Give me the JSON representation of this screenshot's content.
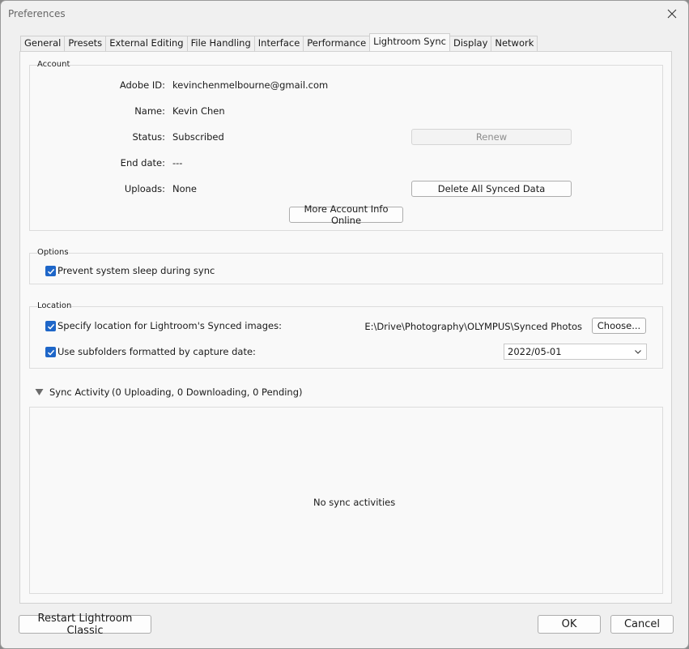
{
  "window": {
    "title": "Preferences"
  },
  "tabs": [
    {
      "label": "General"
    },
    {
      "label": "Presets"
    },
    {
      "label": "External Editing"
    },
    {
      "label": "File Handling"
    },
    {
      "label": "Interface"
    },
    {
      "label": "Performance"
    },
    {
      "label": "Lightroom Sync",
      "active": true
    },
    {
      "label": "Display"
    },
    {
      "label": "Network"
    }
  ],
  "account": {
    "group_label": "Account",
    "adobe_id_label": "Adobe ID:",
    "adobe_id_value": "kevinchenmelbourne@gmail.com",
    "name_label": "Name:",
    "name_value": "Kevin Chen",
    "status_label": "Status:",
    "status_value": "Subscribed",
    "end_date_label": "End date:",
    "end_date_value": "---",
    "uploads_label": "Uploads:",
    "uploads_value": "None",
    "renew_button": "Renew",
    "delete_button": "Delete All Synced Data",
    "more_info_button": "More Account Info Online"
  },
  "options": {
    "group_label": "Options",
    "prevent_sleep_label": "Prevent system sleep during sync",
    "prevent_sleep_checked": true
  },
  "location": {
    "group_label": "Location",
    "specify_label": "Specify location for Lightroom's Synced images:",
    "specify_checked": true,
    "path": "E:\\Drive\\Photography\\OLYMPUS\\Synced Photos",
    "choose_button": "Choose...",
    "subfolders_label": "Use subfolders formatted by capture date:",
    "subfolders_checked": true,
    "date_format": "2022/05-01"
  },
  "sync_activity": {
    "label": "Sync Activity",
    "summary": "(0 Uploading, 0 Downloading, 0 Pending)",
    "empty_message": "No sync activities"
  },
  "footer": {
    "restart_button": "Restart Lightroom Classic",
    "ok_button": "OK",
    "cancel_button": "Cancel"
  },
  "colors": {
    "accent": "#1e66c8",
    "window_bg": "#f0f0f0",
    "panel_bg": "#f9f9f9"
  },
  "icons": {
    "close": "close-icon",
    "check": "checkmark-icon",
    "dropdown": "chevron-down-icon",
    "disclosure": "triangle-down-icon"
  }
}
